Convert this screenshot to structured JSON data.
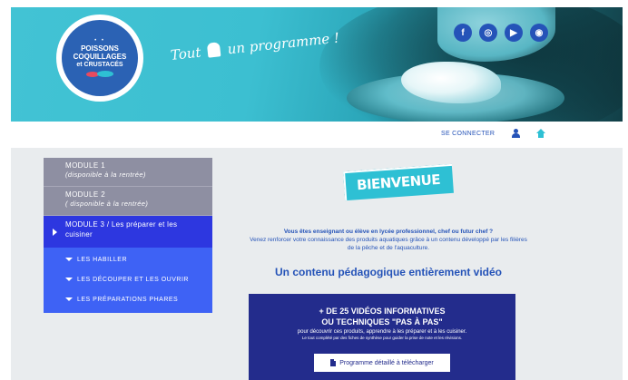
{
  "banner": {
    "logo": {
      "dots": "• •",
      "line1": "POISSONS",
      "line2": "COQUILLAGES",
      "line3": "et CRUSTACÉS"
    },
    "tagline_before": "Tout",
    "tagline_after": "un programme !",
    "socials": [
      {
        "name": "facebook",
        "glyph": "f"
      },
      {
        "name": "instagram",
        "glyph": "◎"
      },
      {
        "name": "youtube",
        "glyph": "▶"
      },
      {
        "name": "website",
        "glyph": "◉"
      }
    ]
  },
  "topnav": {
    "connect": "SE CONNECTER"
  },
  "sidebar": {
    "modules": [
      {
        "title": "MODULE 1",
        "subtitle": "(disponible à la rentrée)"
      },
      {
        "title": "MODULE 2",
        "subtitle": "( disponible à la rentrée)"
      },
      {
        "title": "MODULE 3 / Les préparer et les cuisiner"
      }
    ],
    "subitems": [
      "LES HABILLER",
      "LES DÉCOUPER ET LES OUVRIR",
      "LES PRÉPARATIONS PHARES"
    ]
  },
  "content": {
    "badge": "BIENVENUE",
    "question": "Vous êtes enseignant ou élève en lycée professionnel, chef ou futur chef ?",
    "intro": "Venez renforcer votre connaissance des produits aquatiques grâce à un contenu développé par les filières de la pêche et de l'aquaculture.",
    "headline": "Un contenu pédagogique entièrement vidéo"
  },
  "promo": {
    "line1": "+ DE 25 VIDÉOS INFORMATIVES",
    "line2": "OU TECHNIQUES \"PAS À PAS\"",
    "desc": "pour découvrir ces produits, apprendre à les préparer et à les cuisiner.",
    "desc2": "Le tout complété par des fiches de synthèse pour guider la prise de note et les révisions.",
    "button": "Programme détaillé à télécharger"
  },
  "colors": {
    "brand_blue": "#2553b8",
    "cyan": "#2ec0d4",
    "active_module": "#2d37e0",
    "promo_bg": "#232c8c"
  }
}
